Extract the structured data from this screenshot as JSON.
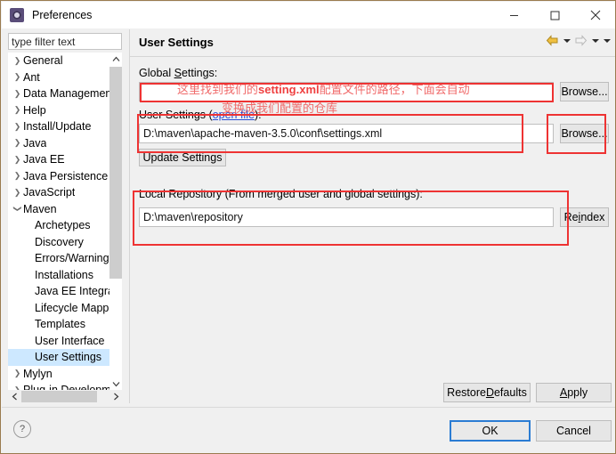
{
  "window": {
    "title": "Preferences",
    "icon": "eclipse-preferences-icon",
    "minimize_label": "–",
    "maximize_label": "□",
    "close_label": "✕"
  },
  "sidebar": {
    "filter_placeholder": "type filter text",
    "filter_value": "",
    "items": [
      {
        "label": "General",
        "level": 0,
        "expandable": true,
        "expanded": false,
        "selected": false
      },
      {
        "label": "Ant",
        "level": 0,
        "expandable": true,
        "expanded": false,
        "selected": false
      },
      {
        "label": "Data Management",
        "level": 0,
        "expandable": true,
        "expanded": false,
        "selected": false
      },
      {
        "label": "Help",
        "level": 0,
        "expandable": true,
        "expanded": false,
        "selected": false
      },
      {
        "label": "Install/Update",
        "level": 0,
        "expandable": true,
        "expanded": false,
        "selected": false
      },
      {
        "label": "Java",
        "level": 0,
        "expandable": true,
        "expanded": false,
        "selected": false
      },
      {
        "label": "Java EE",
        "level": 0,
        "expandable": true,
        "expanded": false,
        "selected": false
      },
      {
        "label": "Java Persistence",
        "level": 0,
        "expandable": true,
        "expanded": false,
        "selected": false
      },
      {
        "label": "JavaScript",
        "level": 0,
        "expandable": true,
        "expanded": false,
        "selected": false
      },
      {
        "label": "Maven",
        "level": 0,
        "expandable": true,
        "expanded": true,
        "selected": false
      },
      {
        "label": "Archetypes",
        "level": 1,
        "expandable": false,
        "expanded": false,
        "selected": false
      },
      {
        "label": "Discovery",
        "level": 1,
        "expandable": false,
        "expanded": false,
        "selected": false
      },
      {
        "label": "Errors/Warnings",
        "level": 1,
        "expandable": false,
        "expanded": false,
        "selected": false
      },
      {
        "label": "Installations",
        "level": 1,
        "expandable": false,
        "expanded": false,
        "selected": false
      },
      {
        "label": "Java EE Integration",
        "level": 1,
        "expandable": false,
        "expanded": false,
        "selected": false
      },
      {
        "label": "Lifecycle Mappings",
        "level": 1,
        "expandable": false,
        "expanded": false,
        "selected": false
      },
      {
        "label": "Templates",
        "level": 1,
        "expandable": false,
        "expanded": false,
        "selected": false
      },
      {
        "label": "User Interface",
        "level": 1,
        "expandable": false,
        "expanded": false,
        "selected": false
      },
      {
        "label": "User Settings",
        "level": 1,
        "expandable": false,
        "expanded": false,
        "selected": true
      },
      {
        "label": "Mylyn",
        "level": 0,
        "expandable": true,
        "expanded": false,
        "selected": false
      },
      {
        "label": "Plug-in Development",
        "level": 0,
        "expandable": true,
        "expanded": false,
        "selected": false
      }
    ]
  },
  "page": {
    "title": "User Settings",
    "nav": {
      "back_icon": "back-arrow-icon",
      "back_menu_icon": "chevron-down-icon",
      "forward_icon": "forward-arrow-icon",
      "forward_menu_icon": "chevron-down-icon",
      "view_menu_icon": "chevron-down-icon"
    },
    "global_settings": {
      "label_prefix": "Global ",
      "label_mnemonic": "S",
      "label_suffix": "ettings:",
      "value": "",
      "browse_label": "Browse..."
    },
    "user_settings": {
      "label_prefix": "User Settings (",
      "label_link": "open file",
      "label_suffix": "):",
      "value": "D:\\maven\\apache-maven-3.5.0\\conf\\settings.xml",
      "browse_label": "Browse...",
      "update_label": "Update Settings"
    },
    "local_repository": {
      "label": "Local Repository (From merged user and global settings):",
      "value": "D:\\maven\\repository",
      "reindex_prefix": "Re",
      "reindex_mnemonic": "i",
      "reindex_suffix": "ndex"
    },
    "annotations": {
      "line1_part1": "这里找到我们的",
      "line1_bold": "setting.xml",
      "line1_part2": "配置文件的路径，下面会自动",
      "line2": "变换成我们配置的仓库",
      "color": "#f06a6a",
      "box_color": "#ee3333"
    }
  },
  "footer": {
    "help_icon": "question-mark-icon",
    "restore_defaults_prefix": "Restore ",
    "restore_defaults_mnemonic": "D",
    "restore_defaults_suffix": "efaults",
    "apply_mnemonic": "A",
    "apply_suffix": "pply",
    "ok_label": "OK",
    "cancel_label": "Cancel"
  }
}
